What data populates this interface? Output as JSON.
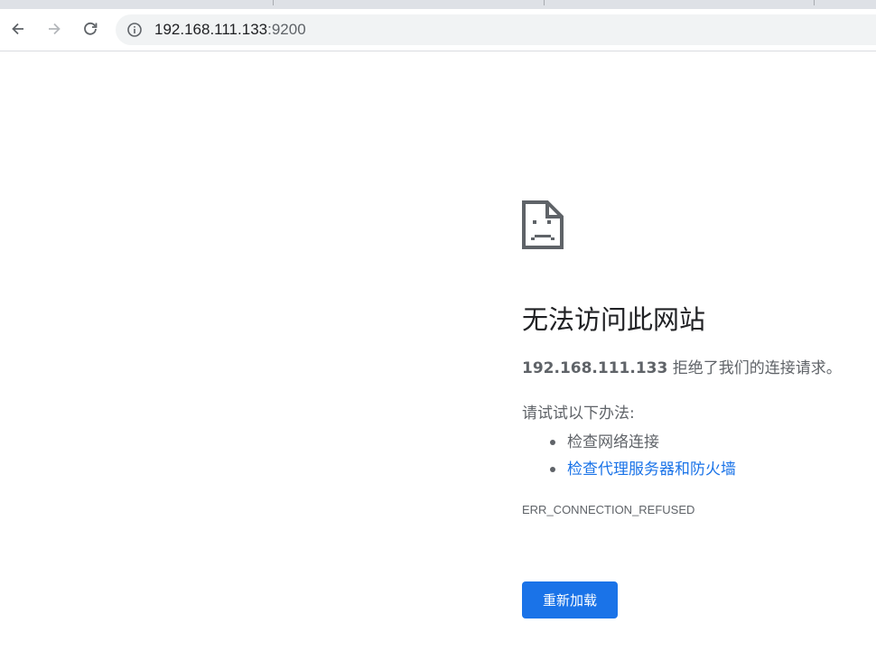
{
  "browser": {
    "address_bar": {
      "host": "192.168.111.133",
      "port": ":9200"
    }
  },
  "error_page": {
    "title": "无法访问此网站",
    "description_host": "192.168.111.133",
    "description_text": " 拒绝了我们的连接请求。",
    "suggest_intro": "请试试以下办法:",
    "suggestions": [
      {
        "label": "检查网络连接",
        "is_link": false
      },
      {
        "label": "检查代理服务器和防火墙",
        "is_link": true
      }
    ],
    "error_code": "ERR_CONNECTION_REFUSED",
    "reload_label": "重新加载"
  },
  "colors": {
    "accent": "#1a73e8",
    "text_secondary": "#5f6368",
    "text_primary": "#202124"
  }
}
